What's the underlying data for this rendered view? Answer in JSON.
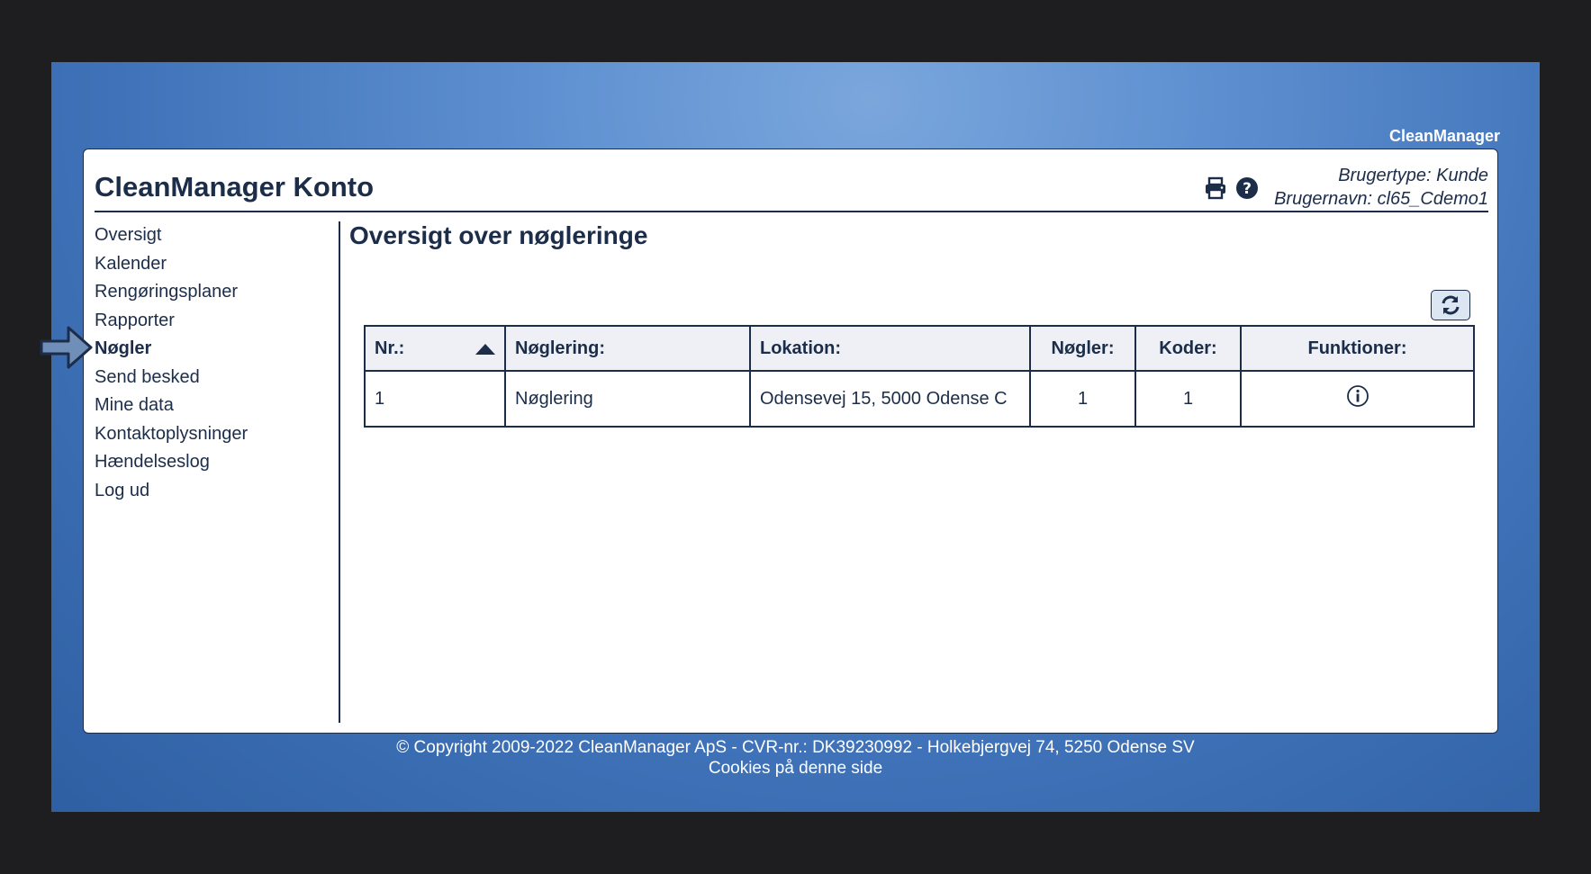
{
  "brand": "CleanManager",
  "panel": {
    "title": "CleanManager Konto",
    "user_type": "Brugertype: Kunde",
    "username": "Brugernavn: cl65_Cdemo1",
    "icons": [
      "print-icon",
      "help-icon"
    ]
  },
  "sidebar": {
    "items": [
      {
        "label": "Oversigt"
      },
      {
        "label": "Kalender"
      },
      {
        "label": "Rengøringsplaner"
      },
      {
        "label": "Rapporter"
      },
      {
        "label": "Nøgler",
        "active": true
      },
      {
        "label": "Send besked"
      },
      {
        "label": "Mine data"
      },
      {
        "label": "Kontaktoplysninger"
      },
      {
        "label": "Hændelseslog"
      },
      {
        "label": "Log ud"
      }
    ]
  },
  "main": {
    "title": "Oversigt over nøgleringe",
    "refresh_icon": "refresh-icon",
    "table": {
      "headers": [
        "Nr.:",
        "Nøglering:",
        "Lokation:",
        "Nøgler:",
        "Koder:",
        "Funktioner:"
      ],
      "sort_icon": "sort-ascending-icon",
      "rows": [
        {
          "nr": "1",
          "keyring": "Nøglering",
          "location": "Odensevej 15, 5000 Odense C",
          "keys": "1",
          "codes": "1",
          "function_icon": "info-icon"
        }
      ]
    }
  },
  "footer": {
    "copyright": "© Copyright 2009-2022 CleanManager ApS - CVR-nr.: DK39230992 - Holkebjergvej 74, 5250 Odense SV",
    "cookies": "Cookies på denne side"
  },
  "pointer_icon": "arrow-right-icon",
  "colors": {
    "navy": "#1c2d4a",
    "background": "#5d8fd0"
  }
}
